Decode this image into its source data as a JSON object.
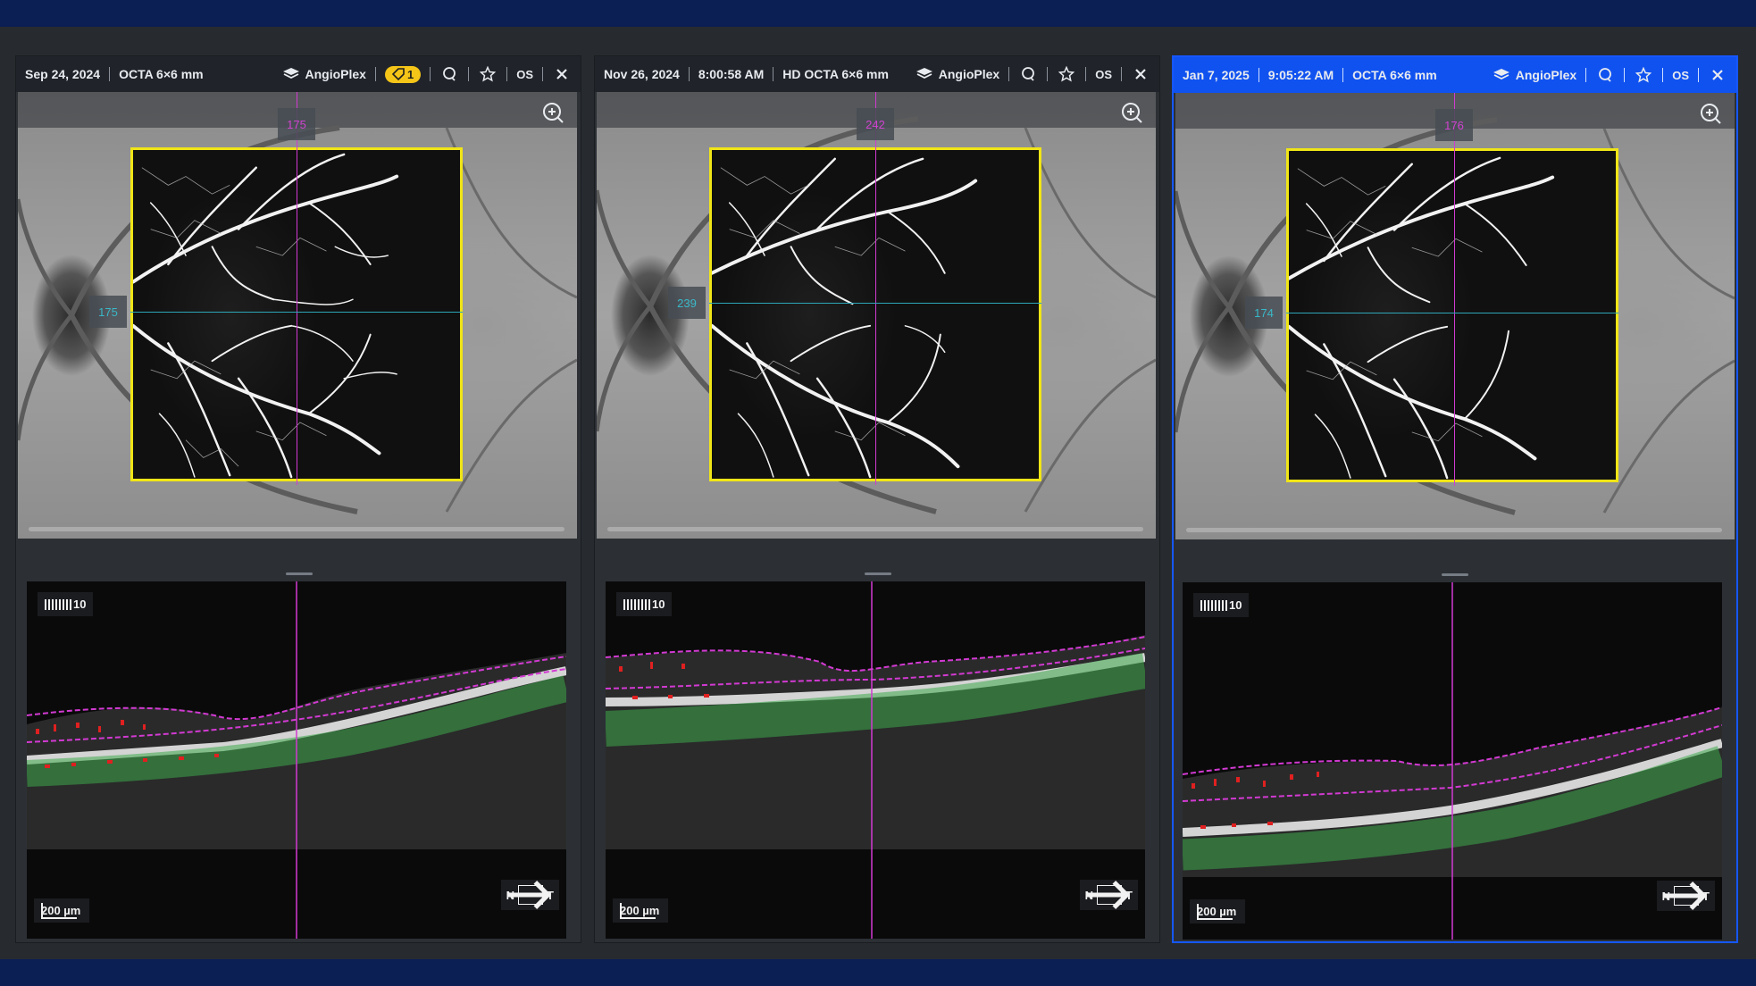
{
  "panels": [
    {
      "date": "Sep 24, 2024",
      "time": "",
      "scan": "OCTA 6×6 mm",
      "device": "AngioPlex",
      "badge": "1",
      "eye": "OS",
      "slice_v": "175",
      "slice_h": "175",
      "brightness": "10",
      "scale": "200 µm",
      "dir_left": "N",
      "dir_right": "T",
      "selected": false
    },
    {
      "date": "Nov 26, 2024",
      "time": "8:00:58 AM",
      "scan": "HD OCTA 6×6 mm",
      "device": "AngioPlex",
      "badge": "",
      "eye": "OS",
      "slice_v": "242",
      "slice_h": "239",
      "brightness": "10",
      "scale": "200 µm",
      "dir_left": "N",
      "dir_right": "T",
      "selected": false
    },
    {
      "date": "Jan 7, 2025",
      "time": "9:05:22 AM",
      "scan": "OCTA 6×6 mm",
      "device": "AngioPlex",
      "badge": "",
      "eye": "OS",
      "slice_v": "176",
      "slice_h": "174",
      "brightness": "10",
      "scale": "200 µm",
      "dir_left": "N",
      "dir_right": "T",
      "selected": true
    }
  ],
  "colors": {
    "selected_header": "#1052f0",
    "octa_border": "#f0e516",
    "vertical_marker": "#d23ad2",
    "horizontal_marker": "#2da6b8",
    "badge": "#f5c518",
    "rpe_green": "#3da84a",
    "segmentation_red": "#e02020"
  },
  "icons": [
    "layers-icon",
    "tag-icon",
    "comment-icon",
    "star-icon",
    "close-icon",
    "zoom-icon",
    "arrow-right-icon"
  ]
}
